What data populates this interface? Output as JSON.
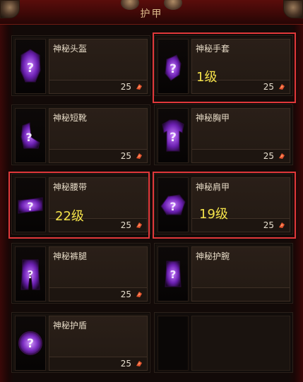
{
  "header": {
    "title": "护甲"
  },
  "items": [
    {
      "name": "神秘头盔",
      "cost": "25",
      "icon": "mystery-helm-icon"
    },
    {
      "name": "神秘手套",
      "cost": "25",
      "icon": "mystery-gloves-icon",
      "note": "1级"
    },
    {
      "name": "神秘短靴",
      "cost": "25",
      "icon": "mystery-boots-icon"
    },
    {
      "name": "神秘胸甲",
      "cost": "25",
      "icon": "mystery-chest-icon"
    },
    {
      "name": "神秘腰带",
      "cost": "25",
      "icon": "mystery-belt-icon",
      "note": "22级"
    },
    {
      "name": "神秘肩甲",
      "cost": "25",
      "icon": "mystery-shoulders-icon",
      "note": "19级"
    },
    {
      "name": "神秘裤腿",
      "cost": "25",
      "icon": "mystery-pants-icon"
    },
    {
      "name": "神秘护腕",
      "cost": "",
      "icon": "mystery-bracers-icon"
    },
    {
      "name": "神秘护盾",
      "cost": "25",
      "icon": "mystery-shield-icon"
    }
  ],
  "colors": {
    "highlight": "#e0383a",
    "note": "#f4e24a",
    "mystery_purple": "#9b3df0"
  }
}
